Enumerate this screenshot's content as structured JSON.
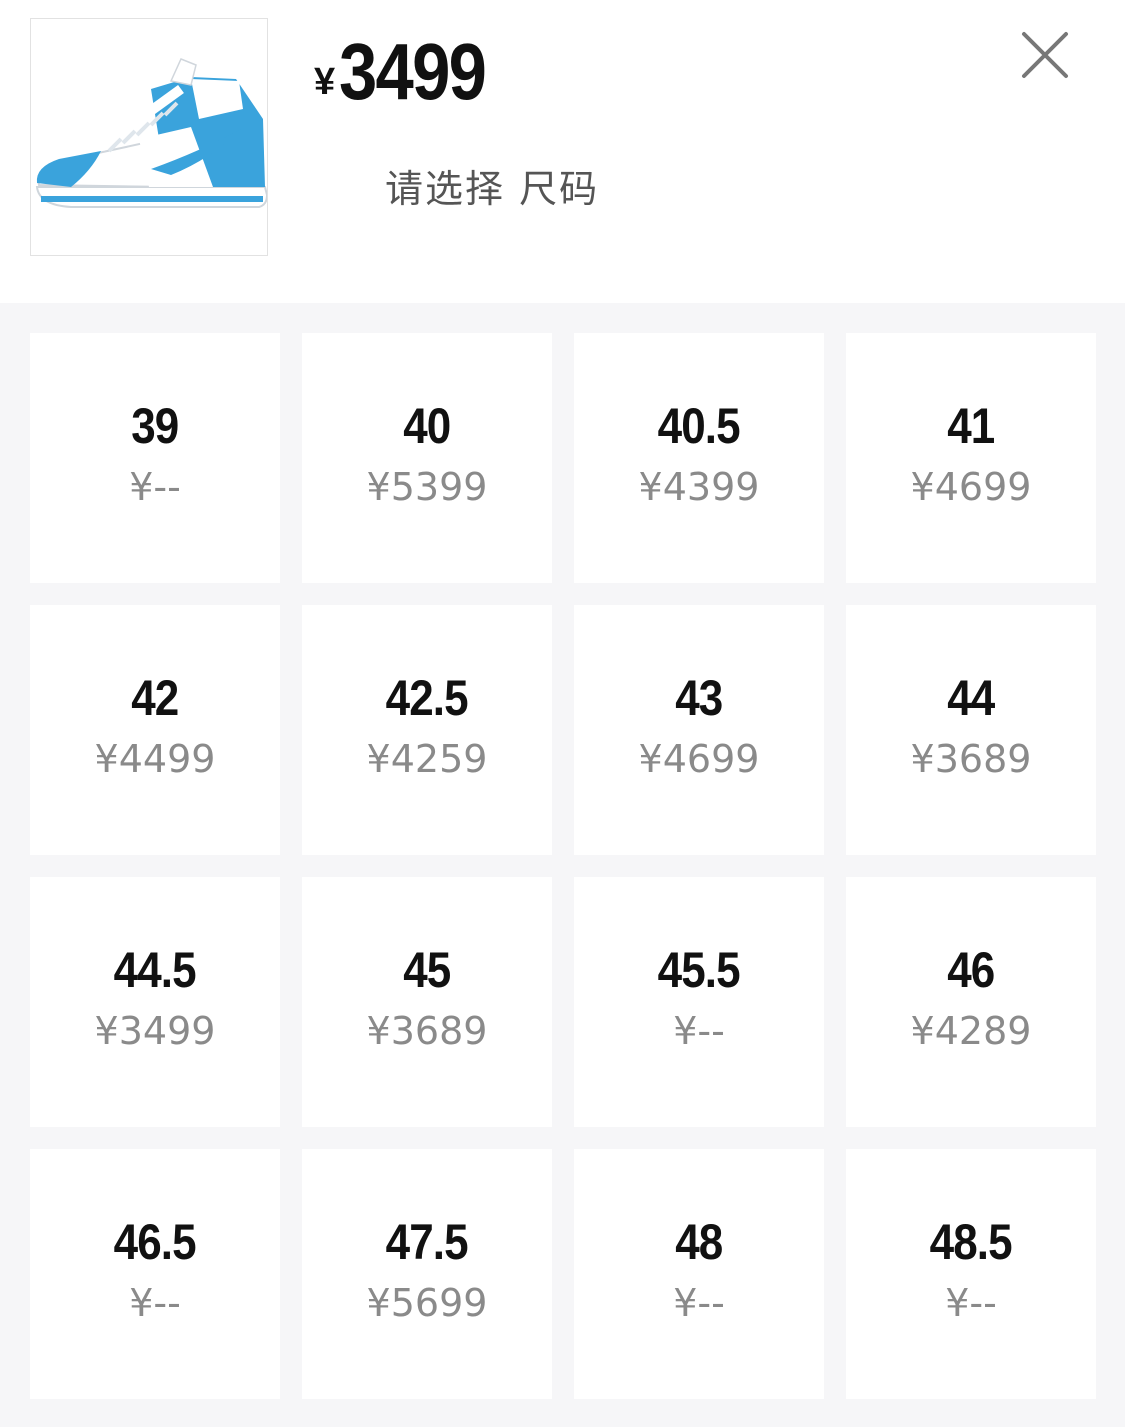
{
  "header": {
    "currency": "¥",
    "price": "3499",
    "hint": "请选择 尺码",
    "product_image": "sneaker-high-top-blue-white"
  },
  "icons": {
    "close": "close-icon"
  },
  "colors": {
    "shoe_blue": "#3aa3dc",
    "background": "#f6f6f8",
    "price_gray": "#8a8a8a"
  },
  "sizes": [
    {
      "size": "39",
      "price": "¥--"
    },
    {
      "size": "40",
      "price": "¥5399"
    },
    {
      "size": "40.5",
      "price": "¥4399"
    },
    {
      "size": "41",
      "price": "¥4699"
    },
    {
      "size": "42",
      "price": "¥4499"
    },
    {
      "size": "42.5",
      "price": "¥4259"
    },
    {
      "size": "43",
      "price": "¥4699"
    },
    {
      "size": "44",
      "price": "¥3689"
    },
    {
      "size": "44.5",
      "price": "¥3499"
    },
    {
      "size": "45",
      "price": "¥3689"
    },
    {
      "size": "45.5",
      "price": "¥--"
    },
    {
      "size": "46",
      "price": "¥4289"
    },
    {
      "size": "46.5",
      "price": "¥--"
    },
    {
      "size": "47.5",
      "price": "¥5699"
    },
    {
      "size": "48",
      "price": "¥--"
    },
    {
      "size": "48.5",
      "price": "¥--"
    }
  ]
}
